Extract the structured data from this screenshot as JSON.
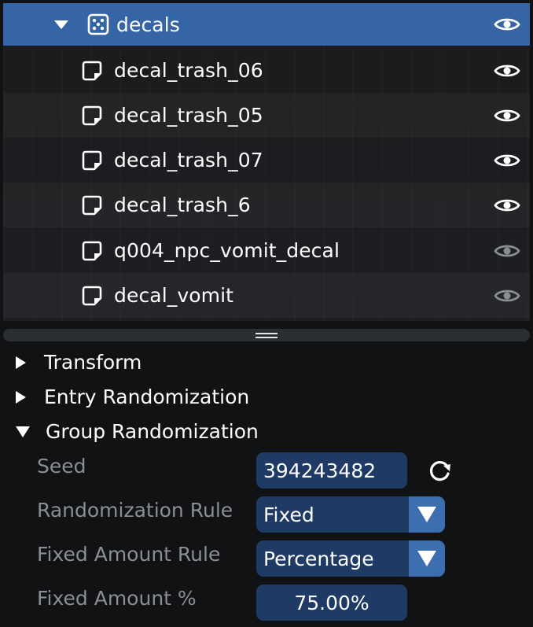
{
  "tree": {
    "group": {
      "label": "decals",
      "icon": "dice-icon",
      "expanded": true,
      "visible": true
    },
    "items": [
      {
        "label": "decal_trash_06",
        "visible": true
      },
      {
        "label": "decal_trash_05",
        "visible": true
      },
      {
        "label": "decal_trash_07",
        "visible": true
      },
      {
        "label": "decal_trash_6",
        "visible": true
      },
      {
        "label": "q004_npc_vomit_decal",
        "visible": false
      },
      {
        "label": "decal_vomit",
        "visible": false
      }
    ]
  },
  "sections": {
    "transform": "Transform",
    "entry_randomization": "Entry Randomization",
    "group_randomization": "Group Randomization"
  },
  "group_randomization": {
    "seed_label": "Seed",
    "seed_value": "394243482",
    "rule_label": "Randomization Rule",
    "rule_value": "Fixed",
    "fixed_rule_label": "Fixed Amount Rule",
    "fixed_rule_value": "Percentage",
    "fixed_amount_label": "Fixed Amount %",
    "fixed_amount_value": "75.00%"
  },
  "colors": {
    "selected_row": "#3565a5",
    "field_bg": "#1f3a64",
    "combo_button": "#3d6fb0",
    "muted_label": "#8b8e93"
  }
}
